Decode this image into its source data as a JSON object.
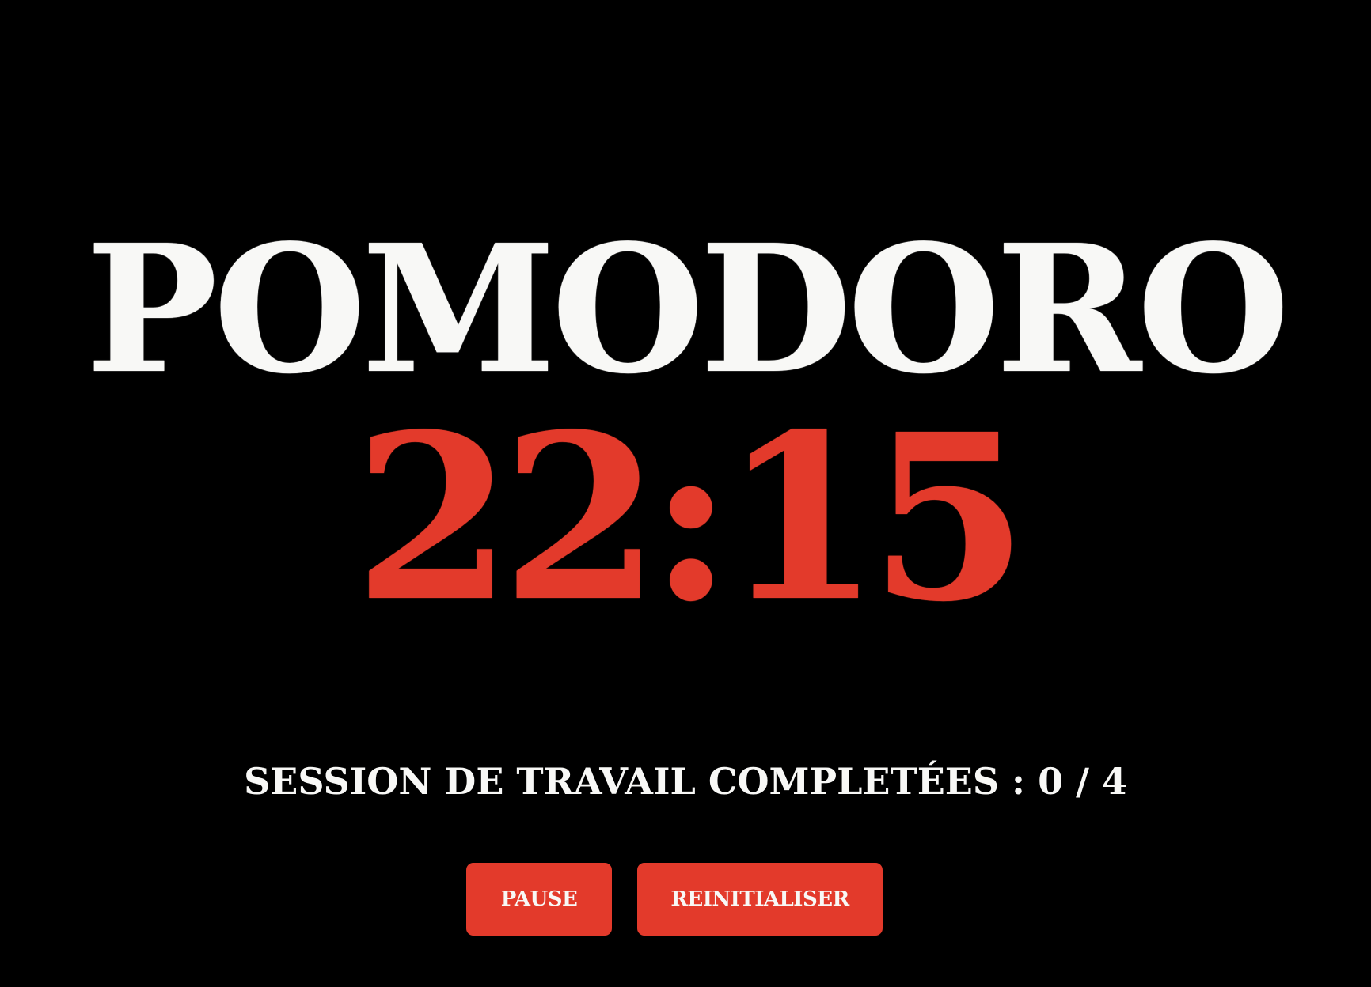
{
  "app": {
    "title": "POMODORO",
    "accent_color": "#e33a2b",
    "text_color": "#f8f8f6",
    "background_color": "#000000"
  },
  "timer": {
    "display": "22:15"
  },
  "sessions": {
    "label": "SESSION DE TRAVAIL COMPLETÉES :",
    "completed": "0",
    "separator": "/",
    "total": "4"
  },
  "controls": {
    "pause_label": "PAUSE",
    "reset_label": "REINITIALISER"
  }
}
